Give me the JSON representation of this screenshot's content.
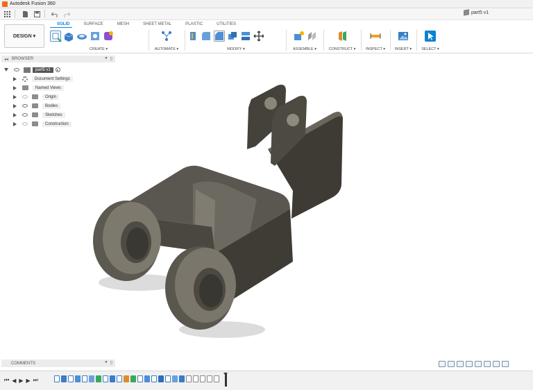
{
  "window": {
    "title": "Autodesk Fusion 360"
  },
  "document": {
    "tab_label": "part5 v1"
  },
  "workspace": {
    "label": "DESIGN ▾"
  },
  "ribbon": {
    "tabs": [
      "SOLID",
      "SURFACE",
      "MESH",
      "SHEET METAL",
      "PLASTIC",
      "UTILITIES"
    ],
    "active_tab": "SOLID",
    "groups": {
      "create": "CREATE ▾",
      "automate": "AUTOMATE ▾",
      "modify": "MODIFY ▾",
      "assemble": "ASSEMBLE ▾",
      "construct": "CONSTRUCT ▾",
      "inspect": "INSPECT ▾",
      "insert": "INSERT ▾",
      "select": "SELECT ▾"
    }
  },
  "browser": {
    "title": "BROWSER",
    "root": "part5 v1",
    "items": [
      "Document Settings",
      "Named Views",
      "Origin",
      "Bodies",
      "Sketches",
      "Construction"
    ]
  },
  "comments": {
    "title": "COMMENTS"
  },
  "colors": {
    "accent": "#0a83d4",
    "brand": "#f26b21",
    "model": "#4a4740"
  }
}
